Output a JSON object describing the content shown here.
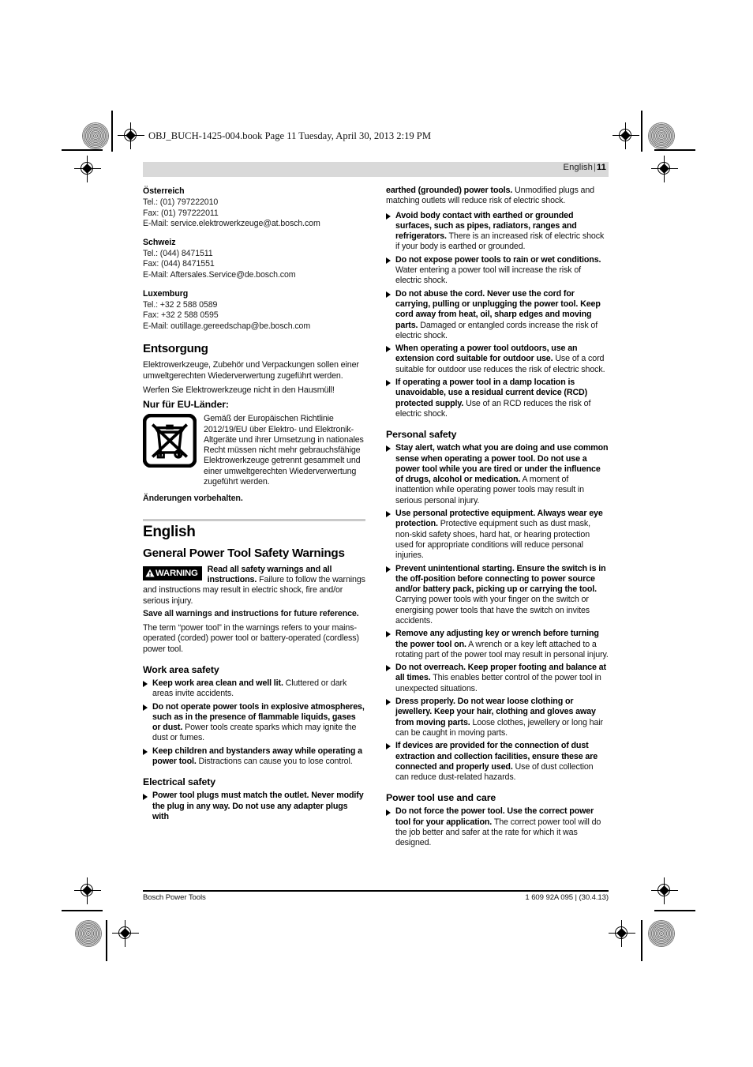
{
  "print_header": {
    "text": "OBJ_BUCH-1425-004.book  Page 11  Tuesday, April 30, 2013  2:19 PM"
  },
  "running_header": {
    "language": "English",
    "separator": "|",
    "page_number": "11"
  },
  "left_column": {
    "service_addresses": [
      {
        "country": "Österreich",
        "lines": [
          "Tel.: (01) 797222010",
          "Fax: (01) 797222011",
          "E-Mail: service.elektrowerkzeuge@at.bosch.com"
        ]
      },
      {
        "country": "Schweiz",
        "lines": [
          "Tel.: (044) 8471511",
          "Fax: (044) 8471551",
          "E-Mail: Aftersales.Service@de.bosch.com"
        ]
      },
      {
        "country": "Luxemburg",
        "lines": [
          "Tel.: +32 2 588 0589",
          "Fax: +32 2 588 0595",
          "E-Mail: outillage.gereedschap@be.bosch.com"
        ]
      }
    ],
    "disposal": {
      "heading": "Entsorgung",
      "para1": "Elektrowerkzeuge, Zubehör und Verpackungen sollen einer umweltgerechten Wiederverwertung zugeführt werden.",
      "para2": "Werfen Sie Elektrowerkzeuge nicht in den Hausmüll!",
      "eu_heading": "Nur für EU-Länder:",
      "weee_text": "Gemäß der Europäischen Richtlinie 2012/19/EU über Elektro- und Elektronik-Altgeräte und ihrer Umsetzung in nationales Recht müssen nicht mehr gebrauchsfähige Elektrowerkzeuge getrennt gesammelt und einer umweltgerechten Wiederverwertung zugeführt werden.",
      "reservation": "Änderungen vorbehalten."
    },
    "english_section": {
      "title": "English",
      "safety_heading": "General Power Tool Safety Warnings",
      "warning_badge": "WARNING",
      "warning_lead": "Read all safety warnings and all instructions.",
      "warning_rest": " Failure to follow the warnings and instructions may result in electric shock, fire and/or serious injury.",
      "save_line": "Save all warnings and instructions for future reference.",
      "term_para": "The term “power tool” in the warnings refers to your mains-operated (corded) power tool or battery-operated (cordless) power tool.",
      "work_area": {
        "heading": "Work area safety",
        "items": [
          {
            "bold": "Keep work area clean and well lit.",
            "rest": " Cluttered or dark areas invite accidents."
          },
          {
            "bold": "Do not operate power tools in explosive atmospheres, such as in the presence of flammable liquids, gases or dust.",
            "rest": " Power tools create sparks which may ignite the dust or fumes."
          },
          {
            "bold": "Keep children and bystanders away while operating a power tool.",
            "rest": " Distractions can cause you to lose control."
          }
        ]
      },
      "electrical": {
        "heading": "Electrical safety",
        "items": [
          {
            "bold": "Power tool plugs must match the outlet. Never modify the plug in any way. Do not use any adapter plugs with",
            "rest": ""
          }
        ]
      }
    }
  },
  "right_column": {
    "electrical_continued": {
      "carryover": {
        "bold": "earthed (grounded) power tools.",
        "rest": " Unmodified plugs and matching outlets will reduce risk of electric shock."
      },
      "items": [
        {
          "bold": "Avoid body contact with earthed or grounded surfaces, such as pipes, radiators, ranges and refrigerators.",
          "rest": " There is an increased risk of electric shock if your body is earthed or grounded."
        },
        {
          "bold": "Do not expose power tools to rain or wet conditions.",
          "rest": " Water entering a power tool will increase the risk of electric shock."
        },
        {
          "bold": "Do not abuse the cord. Never use the cord for carrying, pulling or unplugging the power tool. Keep cord away from heat, oil, sharp edges and moving parts.",
          "rest": " Damaged or entangled cords increase the risk of electric shock."
        },
        {
          "bold": "When operating a power tool outdoors, use an extension cord suitable for outdoor use.",
          "rest": " Use of a cord suitable for outdoor use reduces the risk of electric shock."
        },
        {
          "bold": "If operating a power tool in a damp location is unavoidable, use a residual current device (RCD) protected supply.",
          "rest": " Use of an RCD reduces the risk of electric shock."
        }
      ]
    },
    "personal_safety": {
      "heading": "Personal safety",
      "items": [
        {
          "bold": "Stay alert, watch what you are doing and use common sense when operating a power tool. Do not use a power tool while you are tired or under the influence of drugs, alcohol or medication.",
          "rest": " A moment of inattention while operating power tools may result in serious personal injury."
        },
        {
          "bold": "Use personal protective equipment. Always wear eye protection.",
          "rest": " Protective equipment such as dust mask, non-skid safety shoes, hard hat, or hearing protection used for appropriate conditions will reduce personal injuries."
        },
        {
          "bold": "Prevent unintentional starting. Ensure the switch is in the off-position before connecting to power source and/or battery pack, picking up or carrying the tool.",
          "rest": " Carrying power tools with your finger on the switch or energising power tools that have the switch on invites accidents."
        },
        {
          "bold": "Remove any adjusting key or wrench before turning the power tool on.",
          "rest": " A wrench or a key left attached to a rotating part of the power tool may result in personal injury."
        },
        {
          "bold": "Do not overreach. Keep proper footing and balance at all times.",
          "rest": " This enables better control of the power tool in unexpected situations."
        },
        {
          "bold": "Dress properly. Do not wear loose clothing or jewellery. Keep your hair, clothing and gloves away from moving parts.",
          "rest": " Loose clothes, jewellery or long hair can be caught in moving parts."
        },
        {
          "bold": "If devices are provided for the connection of dust extraction and collection facilities, ensure these are connected and properly used.",
          "rest": " Use of dust collection can reduce dust-related hazards."
        }
      ]
    },
    "tool_use": {
      "heading": "Power tool use and care",
      "items": [
        {
          "bold": "Do not force the power tool. Use the correct power tool for your application.",
          "rest": " The correct power tool will do the job better and safer at the rate for which it was designed."
        }
      ]
    }
  },
  "footer": {
    "left": "Bosch Power Tools",
    "right": "1 609 92A 095 | (30.4.13)"
  }
}
